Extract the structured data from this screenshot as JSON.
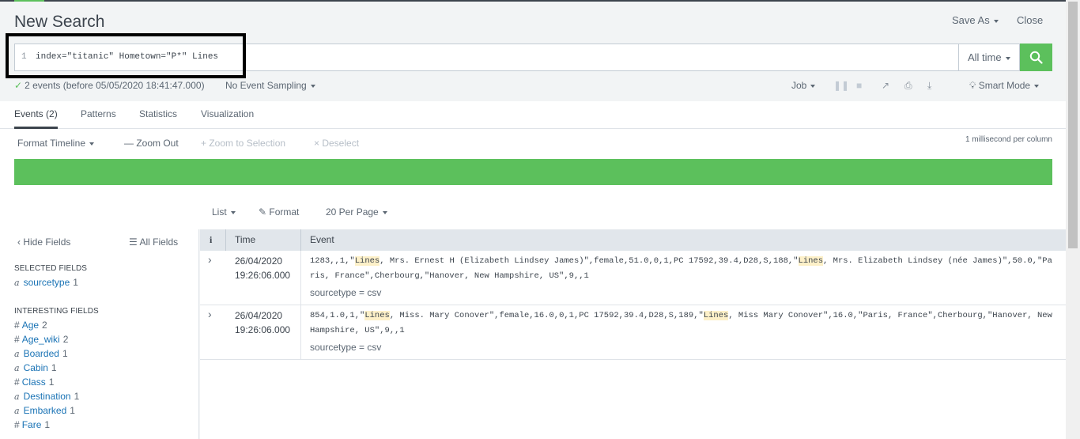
{
  "header": {
    "title": "New Search",
    "save_as": "Save As",
    "close": "Close"
  },
  "search": {
    "line_number": "1",
    "query": "index=\"titanic\" Hometown=\"P*\" Lines",
    "time_range": "All time"
  },
  "status": {
    "check": "✓",
    "summary": "2 events (before 05/05/2020 18:41:47.000)",
    "sampling": "No Event Sampling",
    "job": "Job",
    "mode": "Smart Mode"
  },
  "tabs": [
    {
      "label": "Events (2)"
    },
    {
      "label": "Patterns"
    },
    {
      "label": "Statistics"
    },
    {
      "label": "Visualization"
    }
  ],
  "timeline": {
    "format": "Format Timeline",
    "zoom_out": "— Zoom Out",
    "zoom_selection": "+ Zoom to Selection",
    "deselect": "× Deselect",
    "resolution": "1 millisecond per column"
  },
  "results_controls": {
    "list": "List",
    "format": "Format",
    "per_page": "20 Per Page"
  },
  "sidebar": {
    "hide_fields": "Hide Fields",
    "all_fields": "All Fields",
    "selected_header": "SELECTED FIELDS",
    "selected": [
      {
        "type": "a",
        "name": "sourcetype",
        "count": "1"
      }
    ],
    "interesting_header": "INTERESTING FIELDS",
    "interesting": [
      {
        "type": "#",
        "name": "Age",
        "count": "2"
      },
      {
        "type": "#",
        "name": "Age_wiki",
        "count": "2"
      },
      {
        "type": "a",
        "name": "Boarded",
        "count": "1"
      },
      {
        "type": "a",
        "name": "Cabin",
        "count": "1"
      },
      {
        "type": "#",
        "name": "Class",
        "count": "1"
      },
      {
        "type": "a",
        "name": "Destination",
        "count": "1"
      },
      {
        "type": "a",
        "name": "Embarked",
        "count": "1"
      },
      {
        "type": "#",
        "name": "Fare",
        "count": "1"
      }
    ]
  },
  "events_table": {
    "columns": [
      "i",
      "Time",
      "Event"
    ],
    "rows": [
      {
        "date": "26/04/2020",
        "time": "19:26:06.000",
        "raw_parts": [
          "1283,,1,\"",
          "Lines",
          ", Mrs. Ernest H (Elizabeth Lindsey James)\",female,51.0,0,1,PC 17592,39.4,D28,S,188,\"",
          "Lines",
          ", Mrs. Elizabeth Lindsey (née James)\",50.0,\"Paris, France\",Cherbourg,\"Hanover, New Hampshire, US\",9,,1"
        ],
        "sourcetype": "sourcetype = csv"
      },
      {
        "date": "26/04/2020",
        "time": "19:26:06.000",
        "raw_parts": [
          "854,1.0,1,\"",
          "Lines",
          ", Miss. Mary Conover\",female,16.0,0,1,PC 17592,39.4,D28,S,189,\"",
          "Lines",
          ", Miss Mary Conover\",16.0,\"Paris, France\",Cherbourg,\"Hanover, New Hampshire, US\",9,,1"
        ],
        "sourcetype": "sourcetype = csv"
      }
    ]
  },
  "colors": {
    "accent_green": "#5cc05c",
    "link_blue": "#1a73b5",
    "highlight": "#fdf0c8"
  }
}
